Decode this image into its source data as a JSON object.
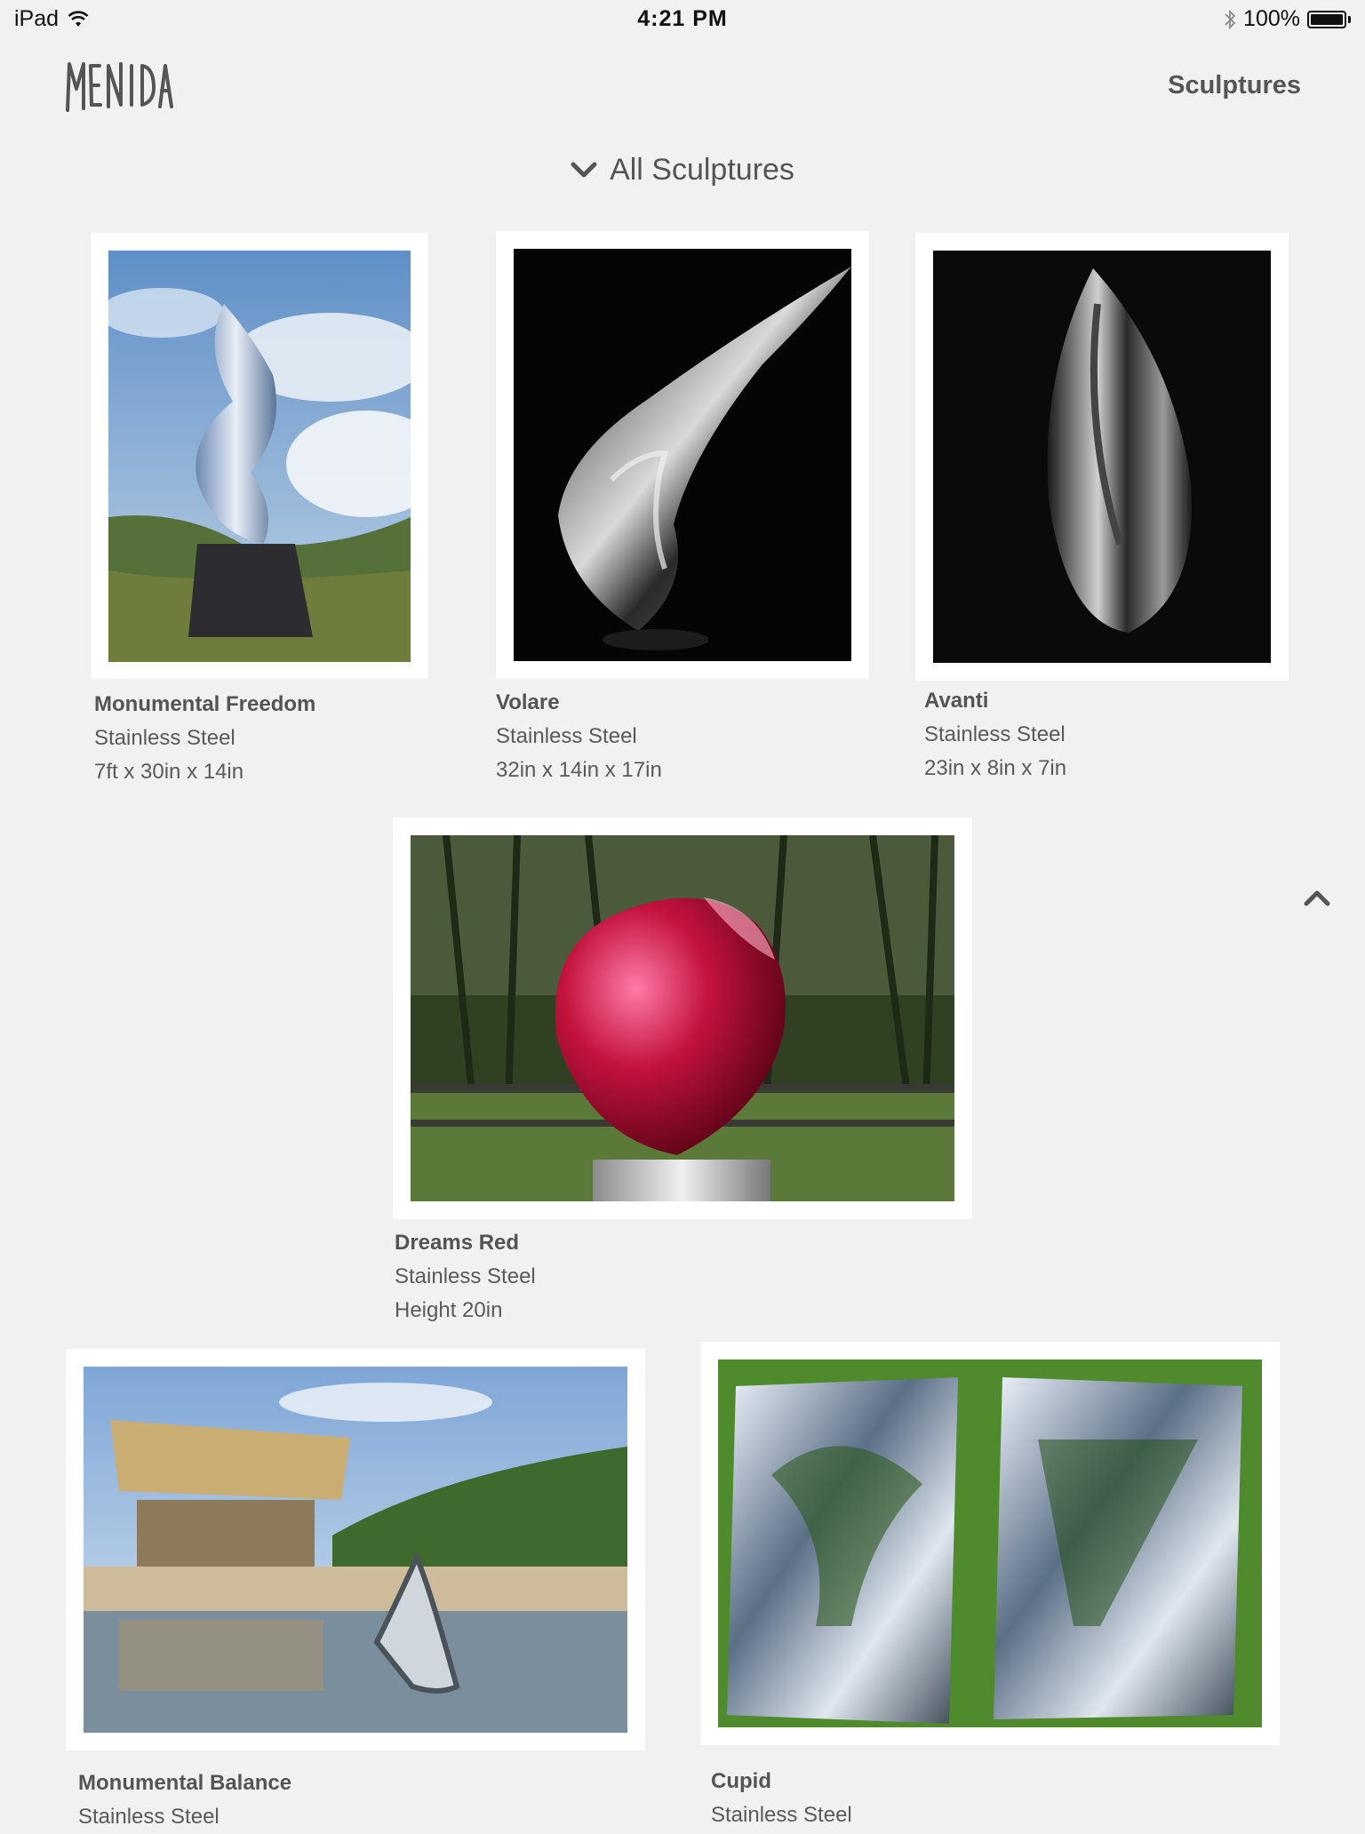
{
  "status_bar": {
    "device": "iPad",
    "time": "4:21 PM",
    "battery": "100%",
    "battery_level": 1.0
  },
  "header": {
    "logo_text": "MENIDA",
    "nav_link": "Sculptures"
  },
  "filter": {
    "label": "All Sculptures"
  },
  "sculptures": [
    {
      "title": "Monumental Freedom",
      "material": "Stainless Steel",
      "dimensions": "7ft x 30in x 14in"
    },
    {
      "title": "Volare",
      "material": "Stainless Steel",
      "dimensions": "32in x 14in x 17in"
    },
    {
      "title": "Avanti",
      "material": "Stainless Steel",
      "dimensions": "23in x 8in x 7in"
    },
    {
      "title": "Dreams Red",
      "material": "Stainless Steel",
      "dimensions": "Height 20in"
    },
    {
      "title": "Monumental Balance",
      "material": "Stainless Steel"
    },
    {
      "title": "Cupid",
      "material": "Stainless Steel"
    }
  ],
  "icons": {
    "wifi": "wifi-icon",
    "bluetooth": "bluetooth-icon",
    "battery": "battery-icon",
    "filter_toggle": "chevron-down-icon",
    "back_to_top": "chevron-up-icon"
  }
}
